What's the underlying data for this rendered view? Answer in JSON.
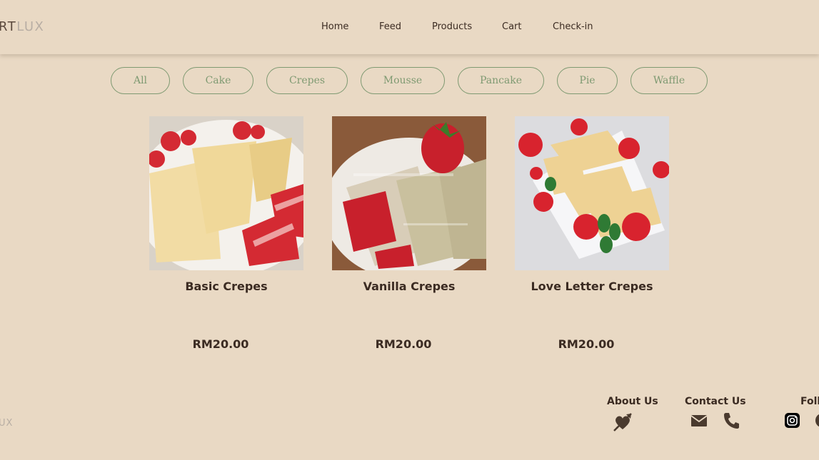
{
  "header": {
    "logo_part1": "RT",
    "logo_part2": "LUX",
    "nav": [
      "Home",
      "Feed",
      "Products",
      "Cart",
      "Check-in"
    ]
  },
  "filters": [
    "All",
    "Cake",
    "Crepes",
    "Mousse",
    "Pancake",
    "Pie",
    "Waffle"
  ],
  "products": [
    {
      "name": "Basic Crepes",
      "price": "RM20.00"
    },
    {
      "name": "Vanilla Crepes",
      "price": "RM20.00"
    },
    {
      "name": "Love Letter Crepes",
      "price": "RM20.00"
    }
  ],
  "footer": {
    "logo": "UX",
    "about_title": "About Us",
    "contact_title": "Contact Us",
    "follow_title": "Foll",
    "icons": [
      "heart-arrow-icon",
      "mail-icon",
      "phone-icon",
      "instagram-icon"
    ]
  },
  "colors": {
    "background": "#e9d9c4",
    "accent_green": "#7f9a72",
    "text_dark": "#3b2b22"
  }
}
